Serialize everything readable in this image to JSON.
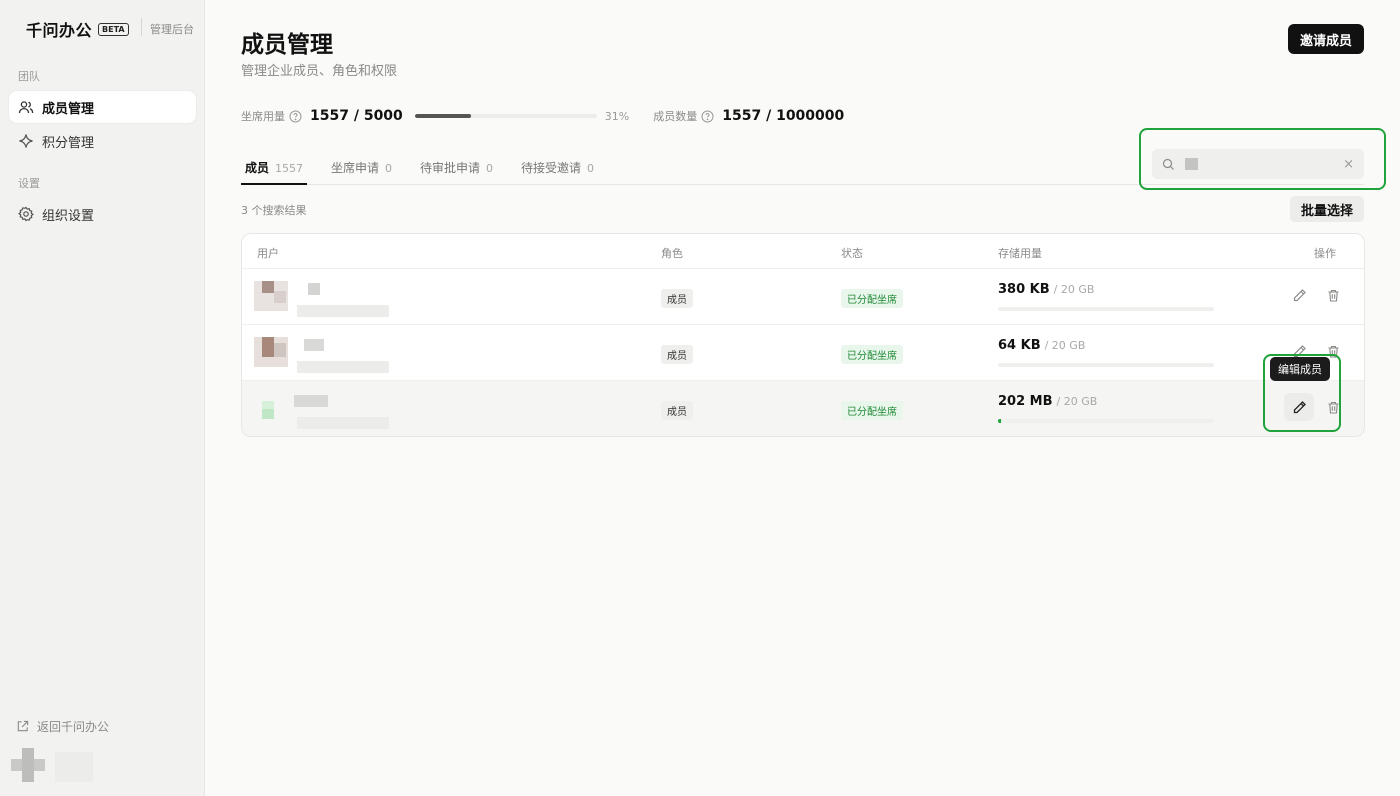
{
  "brand": {
    "name": "千问办公",
    "badge": "BETA",
    "subtitle": "管理后台"
  },
  "sidebar": {
    "groups": [
      {
        "label": "团队",
        "items": [
          {
            "label": "成员管理",
            "icon": "users-icon",
            "active": true
          },
          {
            "label": "积分管理",
            "icon": "sparkle-icon",
            "active": false
          }
        ]
      },
      {
        "label": "设置",
        "items": [
          {
            "label": "组织设置",
            "icon": "gear-icon",
            "active": false
          }
        ]
      }
    ],
    "back_link": "返回千问办公"
  },
  "page": {
    "title": "成员管理",
    "subtitle": "管理企业成员、角色和权限",
    "invite_button": "邀请成员"
  },
  "stats": {
    "seat_label": "坐席用量",
    "seat_value": "1557 / 5000",
    "seat_fraction": 0.31,
    "seat_percent": "31%",
    "member_label": "成员数量",
    "member_value": "1557 / 1000000"
  },
  "tabs": [
    {
      "label": "成员",
      "count": "1557",
      "active": true
    },
    {
      "label": "坐席申请",
      "count": "0",
      "active": false
    },
    {
      "label": "待审批申请",
      "count": "0",
      "active": false
    },
    {
      "label": "待接受邀请",
      "count": "0",
      "active": false
    }
  ],
  "search": {
    "clear": "×"
  },
  "results": {
    "count_text": "3 个搜索结果",
    "bulk_button": "批量选择"
  },
  "table": {
    "headers": {
      "user": "用户",
      "role": "角色",
      "status": "状态",
      "storage": "存储用量",
      "actions": "操作"
    },
    "rows": [
      {
        "role": "成员",
        "status": "已分配坐席",
        "used": "380 KB",
        "total": "/ 20 GB",
        "fraction": 0.0
      },
      {
        "role": "成员",
        "status": "已分配坐席",
        "used": "64 KB",
        "total": "/ 20 GB",
        "fraction": 0.0
      },
      {
        "role": "成员",
        "status": "已分配坐席",
        "used": "202 MB",
        "total": "/ 20 GB",
        "fraction": 0.01
      }
    ]
  },
  "tooltip": {
    "text": "编辑成员"
  },
  "colors": {
    "accent": "#1fa33a",
    "status_text": "#1e8a35",
    "status_bg": "#e9f6ec",
    "primary_button": "#111111"
  }
}
